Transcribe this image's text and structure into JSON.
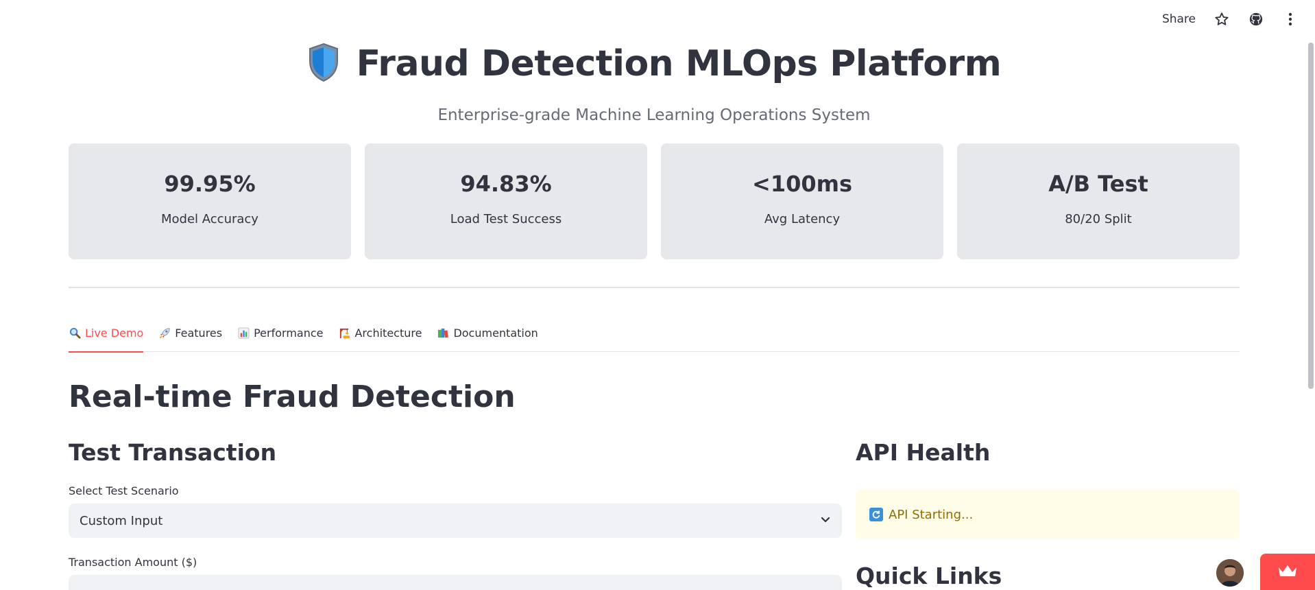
{
  "header": {
    "share_label": "Share"
  },
  "page": {
    "title": "Fraud Detection MLOps Platform",
    "subtitle": "Enterprise-grade Machine Learning Operations System"
  },
  "metrics": [
    {
      "value": "99.95%",
      "label": "Model Accuracy"
    },
    {
      "value": "94.83%",
      "label": "Load Test Success"
    },
    {
      "value": "<100ms",
      "label": "Avg Latency"
    },
    {
      "value": "A/B Test",
      "label": "80/20 Split"
    }
  ],
  "tabs": [
    {
      "label": "Live Demo",
      "icon": "magnifier-icon",
      "active": true
    },
    {
      "label": "Features",
      "icon": "rocket-icon"
    },
    {
      "label": "Performance",
      "icon": "bar-chart-icon"
    },
    {
      "label": "Architecture",
      "icon": "construction-icon"
    },
    {
      "label": "Documentation",
      "icon": "books-icon"
    }
  ],
  "main": {
    "section_title": "Real-time Fraud Detection",
    "test_transaction": {
      "heading": "Test Transaction",
      "scenario_label": "Select Test Scenario",
      "scenario_value": "Custom Input",
      "amount_label": "Transaction Amount ($)"
    },
    "api_health": {
      "heading": "API Health",
      "status_text": "API Starting..."
    },
    "quick_links": {
      "heading": "Quick Links"
    }
  },
  "colors": {
    "accent": "#ff4b4b",
    "metric_bg": "#e7e8ec",
    "warning_bg": "#fffce7",
    "warning_text": "#926c05"
  }
}
